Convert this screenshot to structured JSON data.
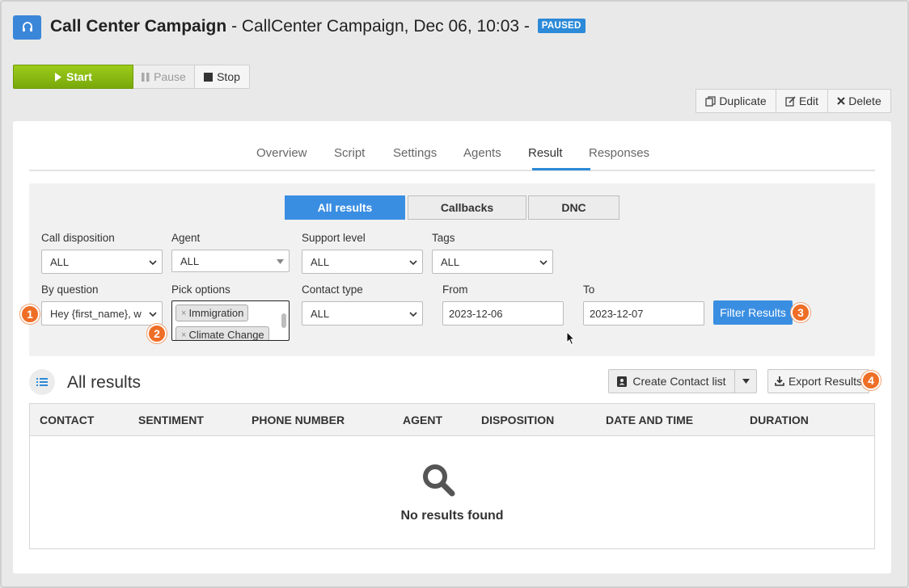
{
  "header": {
    "title_bold": "Call Center Campaign",
    "title_rest": "- CallCenter Campaign, Dec 06, 10:03 -",
    "status_badge": "PAUSED"
  },
  "controls": {
    "start": "Start",
    "pause": "Pause",
    "stop": "Stop"
  },
  "actions": {
    "duplicate": "Duplicate",
    "edit": "Edit",
    "delete": "Delete"
  },
  "tabs": [
    "Overview",
    "Script",
    "Settings",
    "Agents",
    "Result",
    "Responses"
  ],
  "active_tab": "Result",
  "segments": {
    "all_results": "All results",
    "callbacks": "Callbacks",
    "dnc": "DNC",
    "active": "All results"
  },
  "filters": {
    "call_disposition": {
      "label": "Call disposition",
      "value": "ALL"
    },
    "agent": {
      "label": "Agent",
      "value": "ALL"
    },
    "support_level": {
      "label": "Support level",
      "value": "ALL"
    },
    "tags": {
      "label": "Tags",
      "value": "ALL"
    },
    "by_question": {
      "label": "By question",
      "value": "Hey {first_name}, w"
    },
    "pick_options": {
      "label": "Pick options",
      "chips": [
        "Immigration",
        "Climate Change"
      ]
    },
    "contact_type": {
      "label": "Contact type",
      "value": "ALL"
    },
    "from": {
      "label": "From",
      "value": "2023-12-06"
    },
    "to": {
      "label": "To",
      "value": "2023-12-07"
    },
    "filter_button": "Filter Results"
  },
  "callouts": [
    "1",
    "2",
    "3",
    "4"
  ],
  "results": {
    "title": "All results",
    "create_contact_list": "Create Contact list",
    "export": "Export Results",
    "columns": [
      "CONTACT",
      "SENTIMENT",
      "PHONE NUMBER",
      "AGENT",
      "DISPOSITION",
      "DATE AND TIME",
      "DURATION"
    ],
    "empty_message": "No results found"
  },
  "colors": {
    "accent": "#3a8ee2",
    "start_green": "#8cbd12",
    "callout_orange": "#ee6e26"
  },
  "icons": {
    "app": "headset-icon",
    "search": "search-icon",
    "list": "list-icon"
  }
}
